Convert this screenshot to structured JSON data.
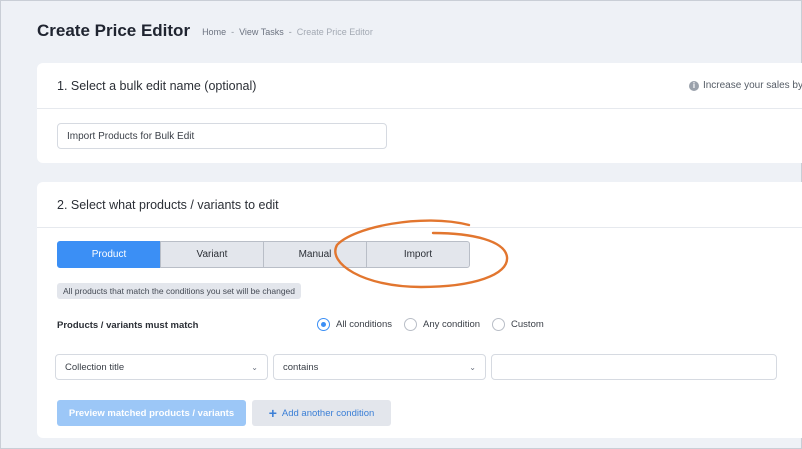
{
  "header": {
    "title": "Create Price Editor",
    "breadcrumb": [
      "Home",
      "View Tasks",
      "Create Price Editor"
    ],
    "separator": "-"
  },
  "section1": {
    "title": "1. Select a bulk edit name (optional)",
    "hint": "Increase your sales by",
    "name_value": "Import Products for Bulk Edit"
  },
  "section2": {
    "title": "2. Select what products / variants to edit",
    "tabs": [
      "Product",
      "Variant",
      "Manual",
      "Import"
    ],
    "active_tab": "Product",
    "note": "All products that match the conditions you set will be changed",
    "match_label": "Products / variants must match",
    "match_options": [
      "All conditions",
      "Any condition",
      "Custom"
    ],
    "match_selected": "All conditions",
    "condition": {
      "field": "Collection title",
      "operator": "contains",
      "value": ""
    },
    "preview_button": "Preview matched products / variants",
    "add_condition_button": "Add another condition"
  },
  "colors": {
    "accent": "#3b8ff5",
    "annotation": "#e2762f"
  },
  "icons": {
    "info": "info-icon",
    "chevron": "chevron-down-icon",
    "plus": "plus-icon"
  }
}
